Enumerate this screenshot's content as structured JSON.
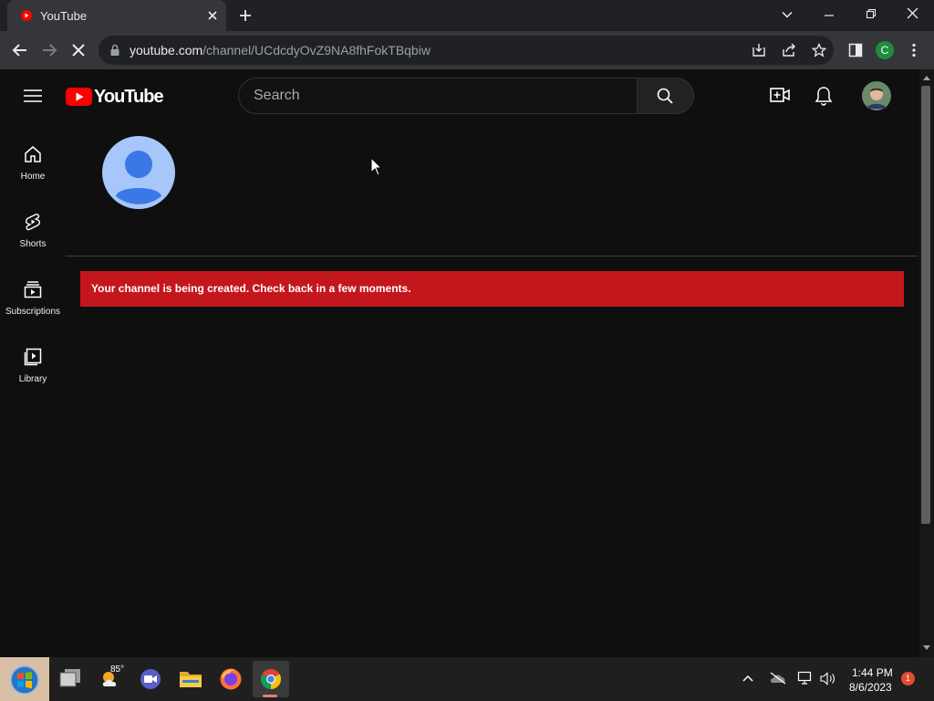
{
  "browser": {
    "tab_title": "YouTube",
    "url_host": "youtube.com",
    "url_path": "/channel/UCdcdyOvZ9NA8fhFokTBqbiw",
    "profile_initial": "C",
    "colors": {
      "tabstrip": "#202124",
      "toolbar": "#35363a",
      "omnibox": "#202124",
      "profile": "#1e8e3e"
    }
  },
  "youtube": {
    "logo_text": "YouTube",
    "search_placeholder": "Search",
    "nav": [
      {
        "label": "Home",
        "icon": "home-icon"
      },
      {
        "label": "Shorts",
        "icon": "shorts-icon"
      },
      {
        "label": "Subscriptions",
        "icon": "subscriptions-icon"
      },
      {
        "label": "Library",
        "icon": "library-icon"
      }
    ],
    "banner_message": "Your channel is being created. Check back in a few moments.",
    "colors": {
      "background": "#0f0f0f",
      "banner": "#c4171d",
      "brand_red": "#ff0000",
      "avatar": "#a7c7fa"
    }
  },
  "taskbar": {
    "weather_temp": "85°",
    "time": "1:44 PM",
    "date": "8/6/2023",
    "notification_count": "1",
    "pinned": [
      "start-orb",
      "task-view",
      "weather",
      "video-chat",
      "file-explorer",
      "firefox",
      "chrome"
    ]
  }
}
